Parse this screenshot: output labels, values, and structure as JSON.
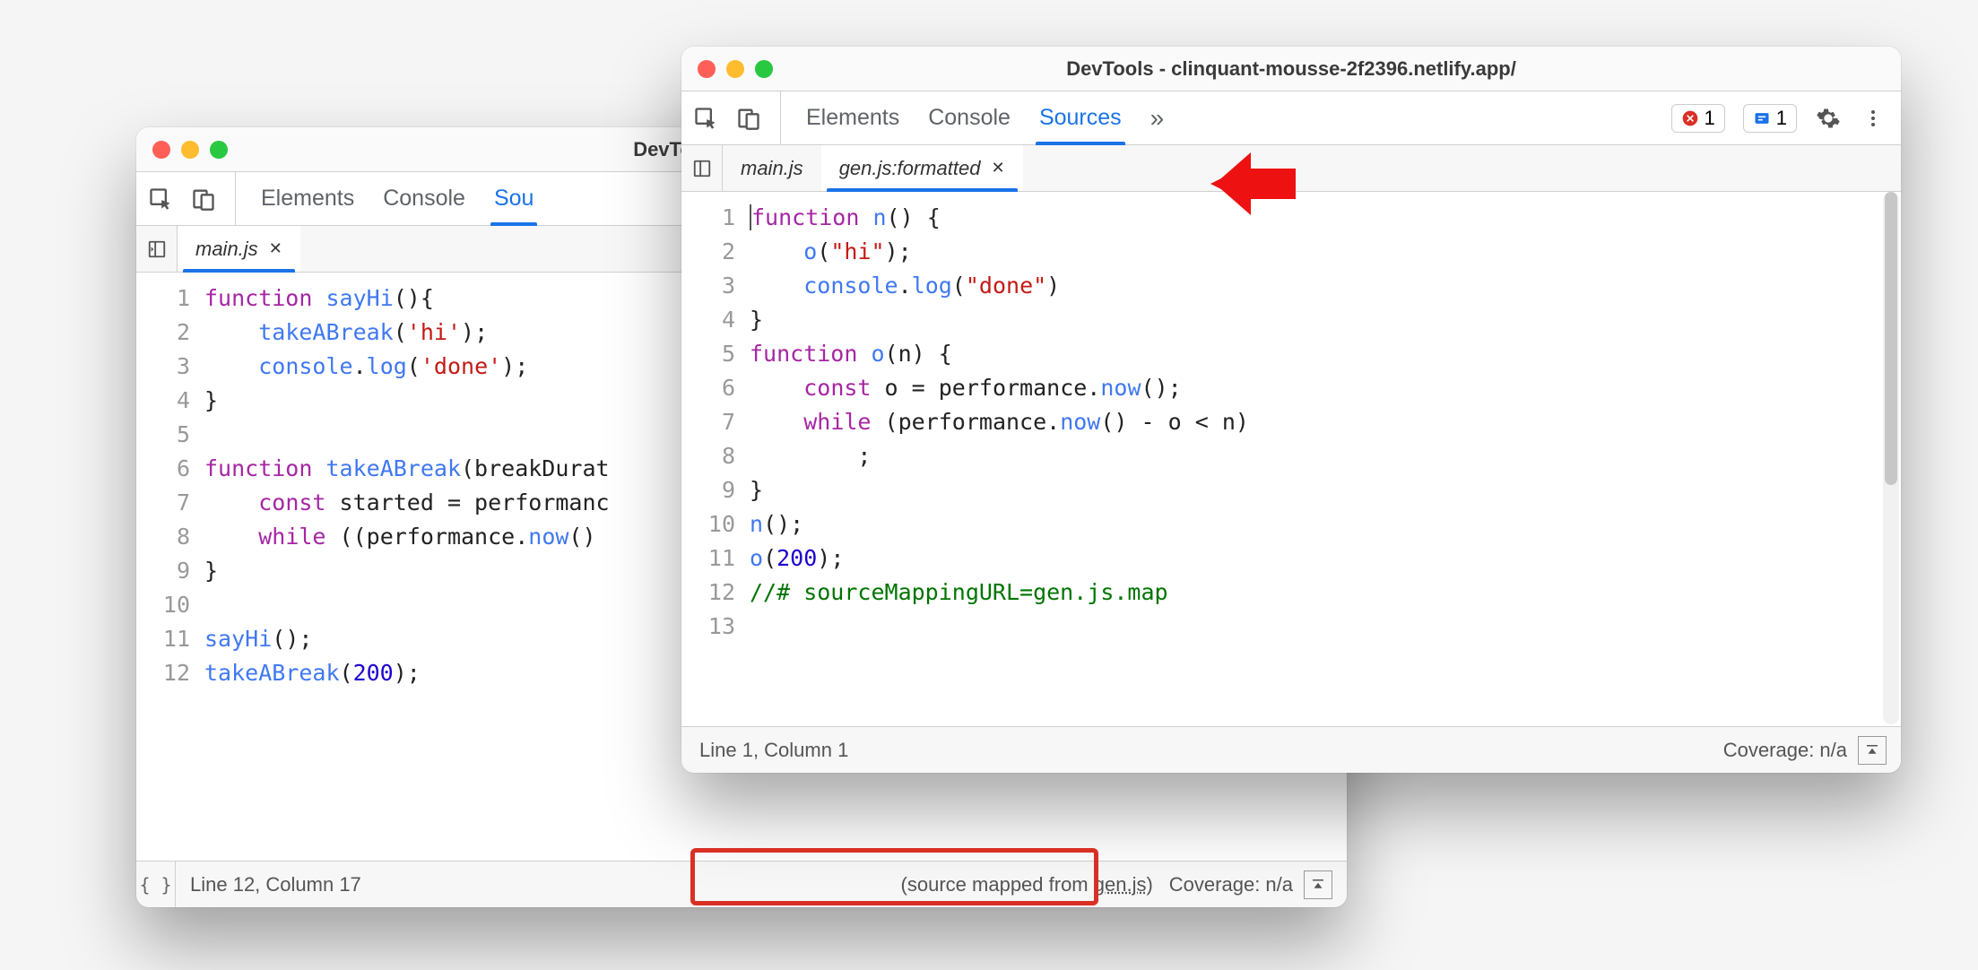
{
  "back": {
    "title": "DevTools - clinquant-m",
    "panels": {
      "elements": "Elements",
      "console": "Console",
      "sources": "Sou"
    },
    "fileTabs": [
      {
        "label": "main.js",
        "active": true
      }
    ],
    "code": [
      [
        [
          "kw",
          "function"
        ],
        " ",
        [
          "fn",
          "sayHi"
        ],
        "(){"
      ],
      [
        "    ",
        [
          "fn",
          "takeABreak"
        ],
        "(",
        [
          "str",
          "'hi'"
        ],
        ");"
      ],
      [
        "    ",
        [
          "fn",
          "console"
        ],
        ".",
        [
          "fn",
          "log"
        ],
        "(",
        [
          "str",
          "'done'"
        ],
        ");"
      ],
      [
        "}"
      ],
      [
        ""
      ],
      [
        [
          "kw",
          "function"
        ],
        " ",
        [
          "fn",
          "takeABreak"
        ],
        "(breakDurat"
      ],
      [
        "    ",
        [
          "kw",
          "const"
        ],
        " started = performanc"
      ],
      [
        "    ",
        [
          "kw",
          "while"
        ],
        " ((performance.",
        [
          "fn",
          "now"
        ],
        "() "
      ],
      [
        "}"
      ],
      [
        ""
      ],
      [
        [
          "fn",
          "sayHi"
        ],
        "();"
      ],
      [
        [
          "fn",
          "takeABreak"
        ],
        "(",
        [
          "num",
          "200"
        ],
        ");"
      ]
    ],
    "status": {
      "pretty": "{ }",
      "pos": "Line 12, Column 17",
      "mapped_prefix": "(source mapped from ",
      "mapped_link": "gen.js",
      "mapped_suffix": ")",
      "coverage": "Coverage: n/a"
    }
  },
  "front": {
    "title": "DevTools - clinquant-mousse-2f2396.netlify.app/",
    "panels": {
      "elements": "Elements",
      "console": "Console",
      "sources": "Sources",
      "more": "»"
    },
    "badges": {
      "errors": "1",
      "issues": "1"
    },
    "fileTabs": [
      {
        "label": "main.js",
        "active": false
      },
      {
        "label": "gen.js:formatted",
        "active": true
      }
    ],
    "code": [
      [
        [
          "kw",
          "function"
        ],
        " ",
        [
          "fn",
          "n"
        ],
        "() {"
      ],
      [
        "    ",
        [
          "fn",
          "o"
        ],
        "(",
        [
          "str",
          "\"hi\""
        ],
        ");"
      ],
      [
        "    ",
        [
          "fn",
          "console"
        ],
        ".",
        [
          "fn",
          "log"
        ],
        "(",
        [
          "str",
          "\"done\""
        ],
        ")"
      ],
      [
        "}"
      ],
      [
        [
          "kw",
          "function"
        ],
        " ",
        [
          "fn",
          "o"
        ],
        "(n) {"
      ],
      [
        "    ",
        [
          "kw",
          "const"
        ],
        " o = performance.",
        [
          "fn",
          "now"
        ],
        "();"
      ],
      [
        "    ",
        [
          "kw",
          "while"
        ],
        " (performance.",
        [
          "fn",
          "now"
        ],
        "() - o < n)"
      ],
      [
        "        ;"
      ],
      [
        "}"
      ],
      [
        [
          "fn",
          "n"
        ],
        "();"
      ],
      [
        [
          "fn",
          "o"
        ],
        "(",
        [
          "num",
          "200"
        ],
        ");"
      ],
      [
        [
          "cmt",
          "//# sourceMappingURL=gen.js.map"
        ]
      ],
      [
        ""
      ]
    ],
    "status": {
      "pos": "Line 1, Column 1",
      "coverage": "Coverage: n/a"
    }
  }
}
